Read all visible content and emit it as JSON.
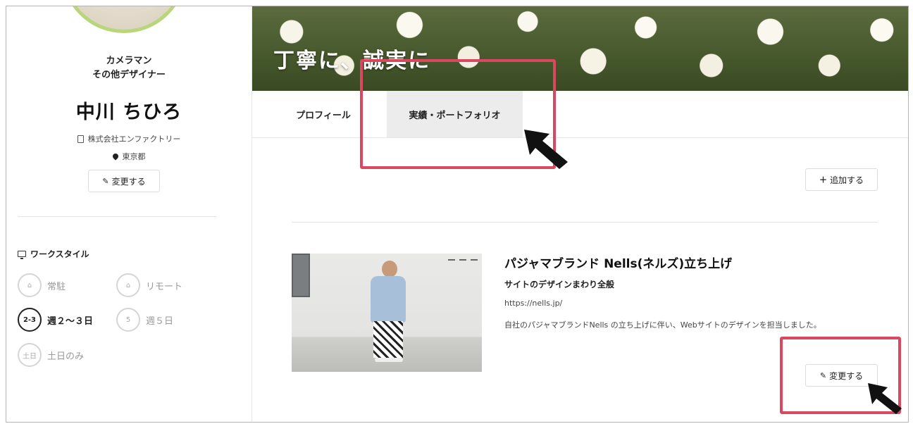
{
  "profile": {
    "job_line1": "カメラマン",
    "job_line2": "その他デザイナー",
    "name": "中川 ちひろ",
    "company": "株式会社エンファクトリー",
    "location": "東京都",
    "edit_label": "変更する"
  },
  "workstyle": {
    "title": "ワークスタイル",
    "items": [
      {
        "label": "常駐",
        "icon_text": "",
        "active": false
      },
      {
        "label": "リモート",
        "icon_text": "",
        "active": false
      },
      {
        "label": "週２～３日",
        "icon_text": "2-3",
        "active": true
      },
      {
        "label": "週５日",
        "icon_text": "5",
        "active": false
      },
      {
        "label": "土日のみ",
        "icon_text": "土日",
        "active": false
      }
    ]
  },
  "hero": {
    "title": "丁寧に、誠実に"
  },
  "tabs": [
    {
      "label": "プロフィール",
      "active": false
    },
    {
      "label": "実績・ポートフォリオ",
      "active": true
    }
  ],
  "portfolio": {
    "add_label": "追加する",
    "item": {
      "title": "パジャマブランド Nells(ネルズ)立ち上げ",
      "subtitle": "サイトのデザインまわり全般",
      "url": "https://nells.jp/",
      "description": "自社のパジャマブランドNells の立ち上げに伴い、Webサイトのデザインを担当しました。",
      "edit_label": "変更する"
    }
  },
  "colors": {
    "highlight": "#d9485f",
    "accent_avatar_ring": "#b9d67a"
  }
}
